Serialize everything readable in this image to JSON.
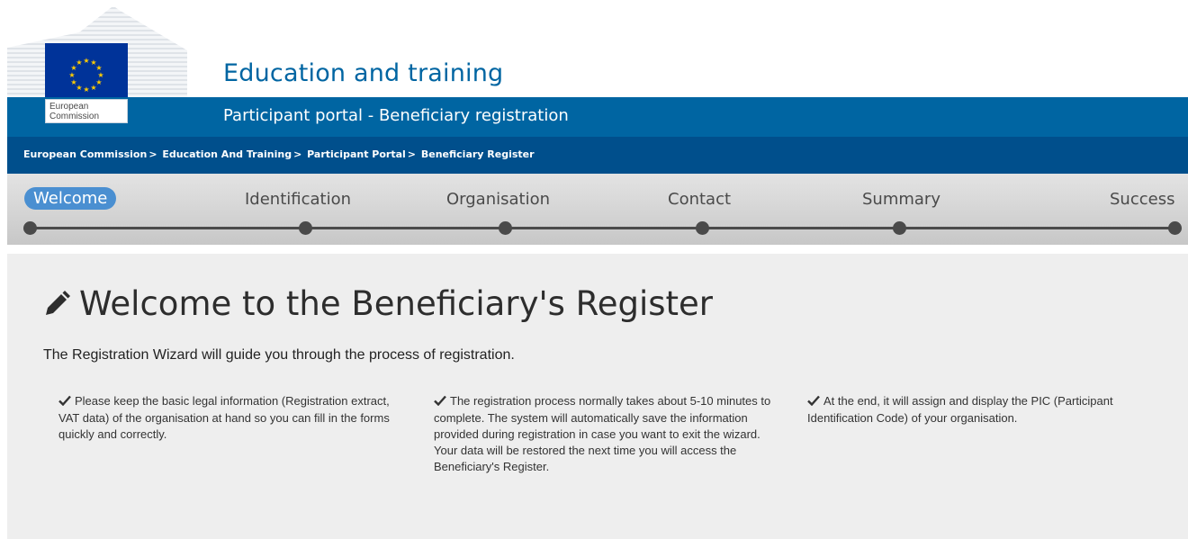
{
  "logo": {
    "line1": "European",
    "line2": "Commission"
  },
  "header": {
    "site_title": "Education and training",
    "sub_title": "Participant portal - Beneficiary registration"
  },
  "breadcrumb": [
    "European Commission",
    "Education And Training",
    "Participant Portal",
    "Beneficiary Register"
  ],
  "steps": [
    {
      "label": "Welcome",
      "active": true
    },
    {
      "label": "Identification",
      "active": false
    },
    {
      "label": "Organisation",
      "active": false
    },
    {
      "label": "Contact",
      "active": false
    },
    {
      "label": "Summary",
      "active": false
    },
    {
      "label": "Success",
      "active": false
    }
  ],
  "main": {
    "heading": "Welcome to the Beneficiary's Register",
    "intro": "The Registration Wizard will guide you through the process of registration.",
    "columns": [
      "Please keep the basic legal information (Registration extract, VAT data) of the organisation at hand so you can fill in the forms quickly and correctly.",
      "The registration process normally takes about 5-10 minutes to complete. The system will automatically save the information provided during registration in case you want to exit the wizard. Your data will be restored the next time you will access the Beneficiary's Register.",
      "At the end, it will assign and display the PIC (Participant Identification Code) of your organisation."
    ]
  },
  "colors": {
    "brand_blue": "#0065a2",
    "breadcrumb_bar": "#004f8c",
    "active_step": "#4a8fd1",
    "panel_bg": "#eeeeee"
  },
  "icons": {
    "heading": "pencil-icon",
    "bullets": "check-icon"
  }
}
